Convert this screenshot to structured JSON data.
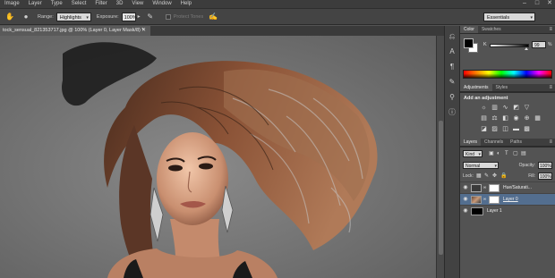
{
  "menu": [
    "Image",
    "Layer",
    "Type",
    "Select",
    "Filter",
    "3D",
    "View",
    "Window",
    "Help"
  ],
  "window_controls": [
    "–",
    "□",
    "✕"
  ],
  "options": {
    "range_label": "Range:",
    "range_value": "Highlights",
    "exposure_label": "Exposure:",
    "exposure_value": "100%",
    "protect_tones": "Protect Tones",
    "workspace": "Essentials"
  },
  "document": {
    "tab_title": "tock_sensual_821353717.jpg @ 100% (Layer 0, Layer Mask/8) *",
    "close": "✕"
  },
  "panels": {
    "color_tabs": [
      "Color",
      "Swatches"
    ],
    "k_label": "K",
    "k_value": "99",
    "k_pct": "%",
    "adjustment_tabs": [
      "Adjustments",
      "Styles"
    ],
    "add_adjustment": "Add an adjustment",
    "layers_tabs": [
      "Layers",
      "Channels",
      "Paths"
    ],
    "filter_kind": "Kind",
    "blend_mode": "Normal",
    "opacity_label": "Opacity:",
    "opacity_value": "100%",
    "lock_label": "Lock:",
    "fill_label": "Fill:",
    "fill_value": "100%",
    "layers": [
      {
        "name": "Hue/Saturati..."
      },
      {
        "name": "Layer 0"
      },
      {
        "name": "Layer 1"
      }
    ]
  },
  "colors": {
    "ui_dark": "#3c3c3c",
    "panel": "#535353",
    "selected_layer": "#536e8f"
  }
}
